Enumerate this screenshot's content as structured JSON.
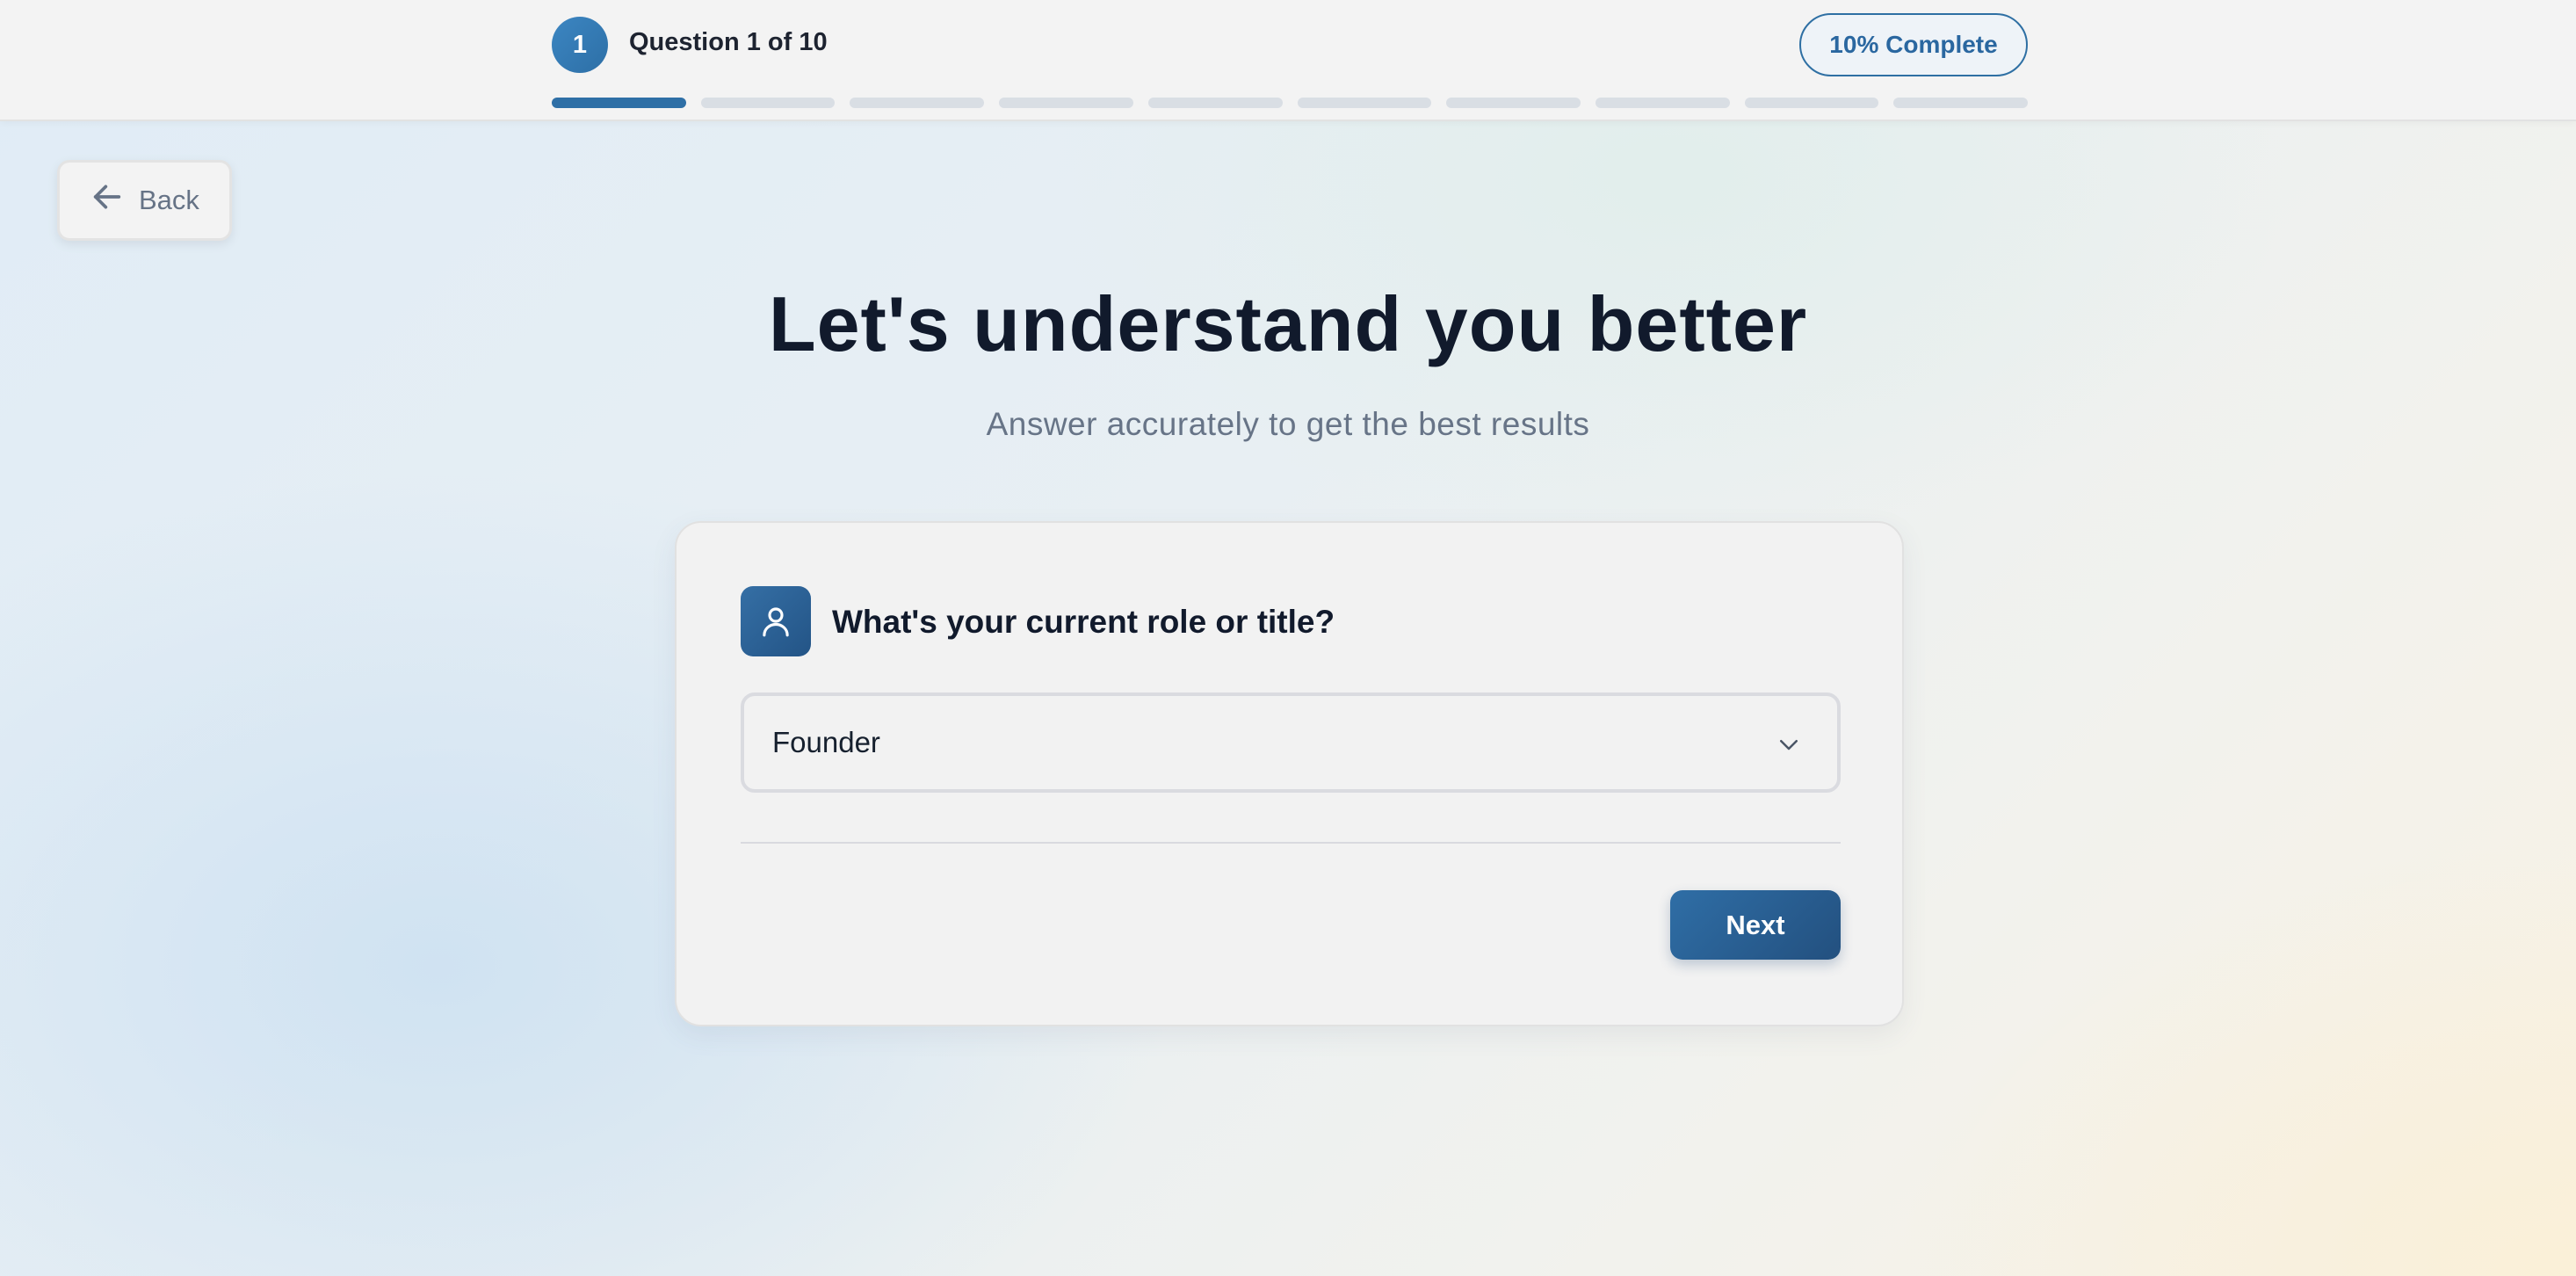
{
  "header": {
    "step_number": "1",
    "step_label": "Question 1 of 10",
    "complete_label": "10% Complete",
    "progress": {
      "total_segments": 10,
      "completed_segments": 1
    }
  },
  "back": {
    "label": "Back"
  },
  "intro": {
    "title": "Let's understand you better",
    "subtitle": "Answer accurately to get the best results"
  },
  "question": {
    "icon": "user-icon",
    "text": "What's your current role or title?",
    "selected_value": "Founder"
  },
  "actions": {
    "next_label": "Next"
  },
  "colors": {
    "accent": "#2e6fa6",
    "heading": "#111a2c",
    "muted": "#677487"
  }
}
